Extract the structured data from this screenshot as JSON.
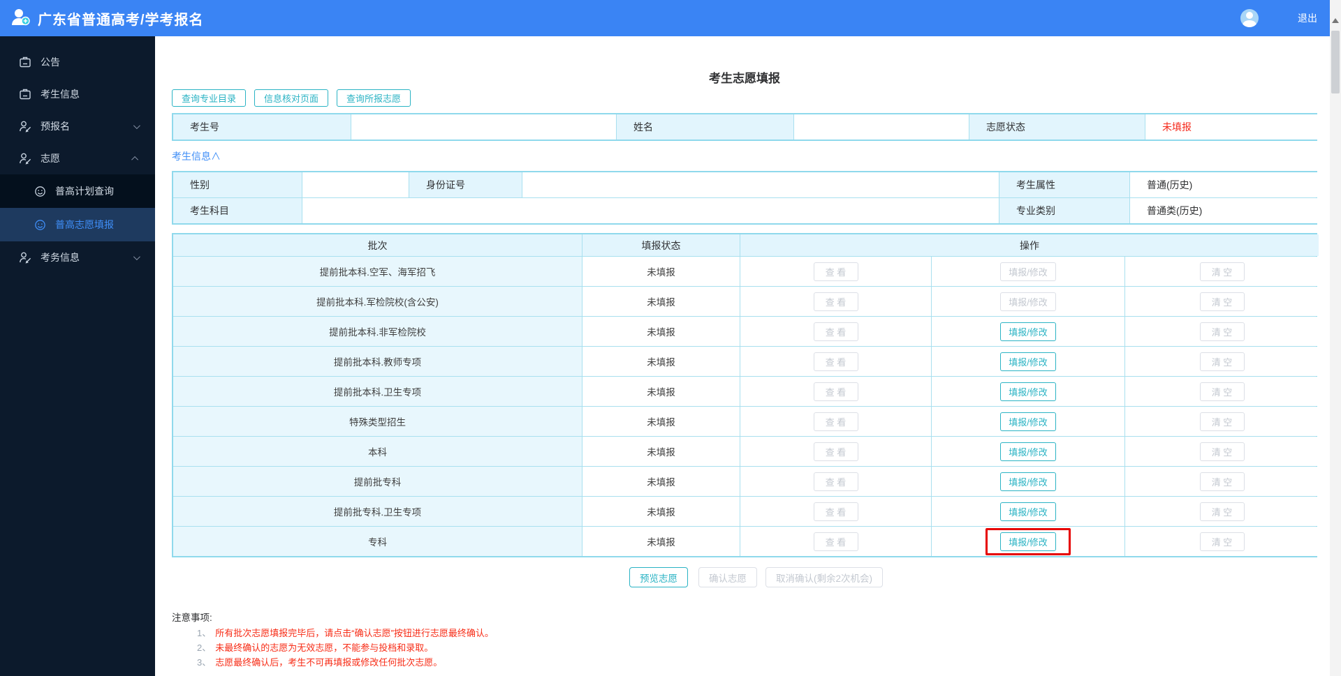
{
  "header": {
    "app_title": "广东省普通高考/学考报名",
    "logout_label": "退出"
  },
  "sidebar": {
    "items": [
      {
        "label": "公告",
        "icon": "notice-icon"
      },
      {
        "label": "考生信息",
        "icon": "notice-icon"
      },
      {
        "label": "预报名",
        "icon": "user-edit-icon",
        "chevron": "down"
      },
      {
        "label": "志愿",
        "icon": "user-edit-icon",
        "chevron": "up"
      },
      {
        "label": "考务信息",
        "icon": "user-edit-icon",
        "chevron": "down"
      }
    ],
    "submenu": [
      {
        "label": "普高计划查询",
        "active": false
      },
      {
        "label": "普高志愿填报",
        "active": true
      }
    ]
  },
  "page_title": "考生志愿填报",
  "toolbar": {
    "btn1": "查询专业目录",
    "btn2": "信息核对页面",
    "btn3": "查询所报志愿"
  },
  "summary": {
    "f1_label": "考生号",
    "f1_value": "",
    "f2_label": "姓名",
    "f2_value": "",
    "f3_label": "志愿状态",
    "f3_value": "未填报"
  },
  "collapse_link": "考生信息∧",
  "info": {
    "sex_label": "性别",
    "sex_value": "",
    "id_label": "身份证号",
    "id_value": "",
    "attr_label": "考生属性",
    "attr_value": "普通(历史)",
    "subj_label": "考生科目",
    "subj_value": "",
    "cat_label": "专业类别",
    "cat_value": "普通类(历史)"
  },
  "batch_table": {
    "col_batch": "批次",
    "col_status": "填报状态",
    "col_op": "操作",
    "view_label": "查 看",
    "fill_label": "填报/修改",
    "clear_label": "清 空",
    "rows": [
      {
        "name": "提前批本科.空军、海军招飞",
        "status": "未填报",
        "fill_class": "tbtn fill-off",
        "wrap_class": "fillwrap"
      },
      {
        "name": "提前批本科.军检院校(含公安)",
        "status": "未填报",
        "fill_class": "tbtn fill-off",
        "wrap_class": "fillwrap"
      },
      {
        "name": "提前批本科.非军检院校",
        "status": "未填报",
        "fill_class": "tbtn fill-on",
        "wrap_class": "fillwrap"
      },
      {
        "name": "提前批本科.教师专项",
        "status": "未填报",
        "fill_class": "tbtn fill-on",
        "wrap_class": "fillwrap"
      },
      {
        "name": "提前批本科.卫生专项",
        "status": "未填报",
        "fill_class": "tbtn fill-on",
        "wrap_class": "fillwrap"
      },
      {
        "name": "特殊类型招生",
        "status": "未填报",
        "fill_class": "tbtn fill-on",
        "wrap_class": "fillwrap"
      },
      {
        "name": "本科",
        "status": "未填报",
        "fill_class": "tbtn fill-on",
        "wrap_class": "fillwrap"
      },
      {
        "name": "提前批专科",
        "status": "未填报",
        "fill_class": "tbtn fill-on",
        "wrap_class": "fillwrap"
      },
      {
        "name": "提前批专科.卫生专项",
        "status": "未填报",
        "fill_class": "tbtn fill-on",
        "wrap_class": "fillwrap"
      },
      {
        "name": "专科",
        "status": "未填报",
        "fill_class": "tbtn fill-on",
        "wrap_class": "fillwrap redbox"
      }
    ]
  },
  "actions": {
    "preview": "预览志愿",
    "confirm": "确认志愿",
    "cancel": "取消确认(剩余2次机会)"
  },
  "notes": {
    "title": "注意事项:",
    "n1_num": "1、",
    "n1_text": "所有批次志愿填报完毕后，请点击“确认志愿”按钮进行志愿最终确认。",
    "n2_num": "2、",
    "n2_text": "未最终确认的志愿为无效志愿，不能参与投档和录取。",
    "n3_num": "3、",
    "n3_text": "志愿最终确认后，考生不可再填报或修改任何批次志愿。"
  },
  "colors": {
    "header_blue": "#3a84f4",
    "accent_teal": "#2ab3c4",
    "status_red": "#f5291b",
    "table_border": "#8fd9ec"
  }
}
